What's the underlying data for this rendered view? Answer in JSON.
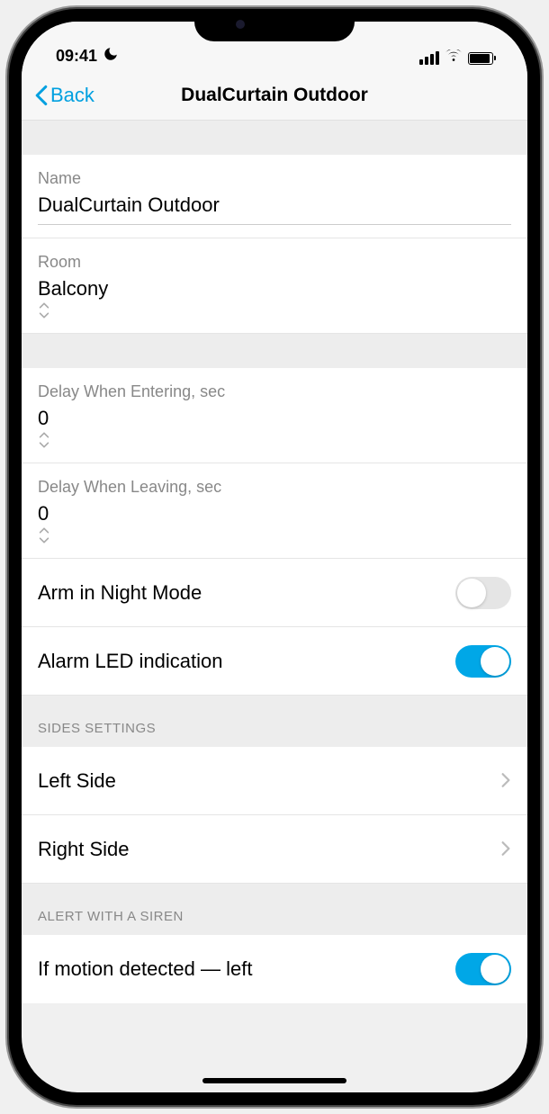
{
  "status": {
    "time": "09:41"
  },
  "nav": {
    "back_label": "Back",
    "title": "DualCurtain Outdoor"
  },
  "fields": {
    "name": {
      "label": "Name",
      "value": "DualCurtain Outdoor"
    },
    "room": {
      "label": "Room",
      "value": "Balcony"
    },
    "delay_enter": {
      "label": "Delay When Entering, sec",
      "value": "0"
    },
    "delay_leave": {
      "label": "Delay When Leaving, sec",
      "value": "0"
    },
    "arm_night": {
      "label": "Arm in Night Mode",
      "on": false
    },
    "alarm_led": {
      "label": "Alarm LED indication",
      "on": true
    }
  },
  "sections": {
    "sides": {
      "header": "SIDES SETTINGS",
      "left": "Left Side",
      "right": "Right Side"
    },
    "alert": {
      "header": "ALERT WITH A SIREN",
      "motion_left": {
        "label": "If motion detected — left",
        "on": true
      }
    }
  }
}
